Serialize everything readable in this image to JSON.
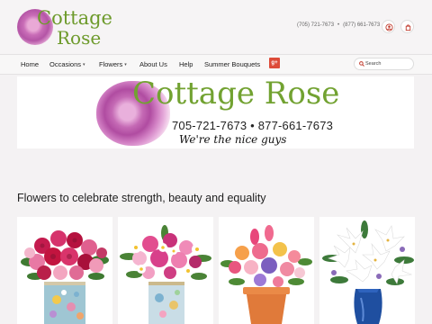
{
  "brand": {
    "name_part1": "Cottage",
    "name_part2": "Rose"
  },
  "header": {
    "phone_local": "(705) 721-7673",
    "separator": "•",
    "phone_tollfree": "(877) 661-7673",
    "account_icon": "user-icon",
    "cart_icon": "shopping-bag-icon"
  },
  "nav": {
    "items": [
      {
        "label": "Home",
        "has_dropdown": false
      },
      {
        "label": "Occasions",
        "has_dropdown": true
      },
      {
        "label": "Flowers",
        "has_dropdown": true
      },
      {
        "label": "About Us",
        "has_dropdown": false
      },
      {
        "label": "Help",
        "has_dropdown": false
      },
      {
        "label": "Summer Bouquets",
        "has_dropdown": false
      }
    ],
    "social_label": "g+",
    "search_placeholder": "Search"
  },
  "banner": {
    "title": "Cottage Rose",
    "phones": "705-721-7673 • 877-661-7673",
    "tagline": "We're the nice guys"
  },
  "main": {
    "headline": "Flowers to celebrate strength, beauty and equality",
    "products": [
      {
        "image": "pink-red-roses-in-painted-tin"
      },
      {
        "image": "pink-daisy-bouquet-in-tin"
      },
      {
        "image": "pink-orange-bouquet-in-terracotta-pot"
      },
      {
        "image": "white-lilies-in-blue-vase"
      }
    ]
  },
  "colors": {
    "brand_green": "#6d9a2b",
    "rose_pink": "#c96db7",
    "gplus_red": "#dd4b39"
  }
}
